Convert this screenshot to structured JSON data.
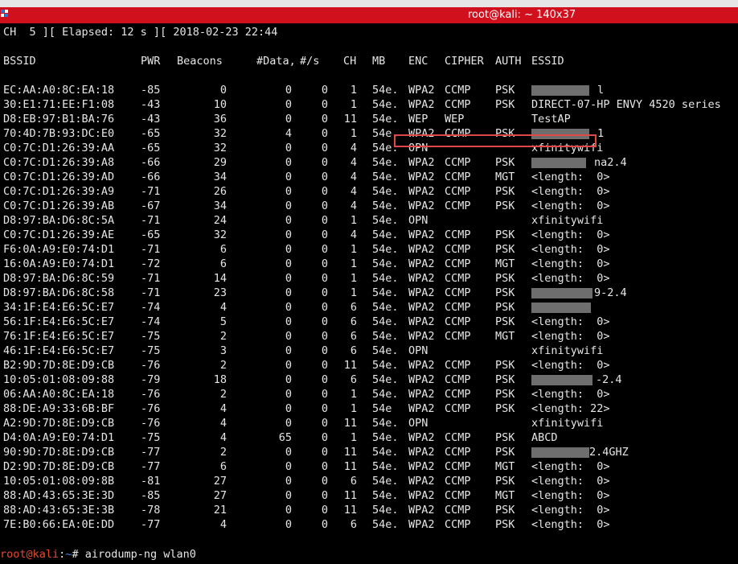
{
  "window": {
    "title": "root@kali: ~ 140x37"
  },
  "status_line": "CH  5 ][ Elapsed: 12 s ][ 2018-02-23 22:44",
  "columns": [
    "BSSID",
    "PWR",
    "Beacons",
    "#Data,",
    "#/s",
    "CH",
    "MB",
    "ENC",
    "CIPHER",
    "AUTH",
    "ESSID"
  ],
  "rows": [
    {
      "bssid": "EC:AA:A0:8C:EA:18",
      "pwr": "-85",
      "beacons": "0",
      "data": "0",
      "rate": "0",
      "ch": "1",
      "mb": "54e.",
      "enc": "WPA2",
      "cipher": "CCMP",
      "auth": "PSK",
      "essid": "l",
      "redacted": true
    },
    {
      "bssid": "30:E1:71:EE:F1:08",
      "pwr": "-43",
      "beacons": "10",
      "data": "0",
      "rate": "0",
      "ch": "1",
      "mb": "54e.",
      "enc": "WPA2",
      "cipher": "CCMP",
      "auth": "PSK",
      "essid": "DIRECT-07-HP ENVY 4520 series",
      "redacted": false
    },
    {
      "bssid": "D8:EB:97:B1:BA:76",
      "pwr": "-43",
      "beacons": "36",
      "data": "0",
      "rate": "0",
      "ch": "11",
      "mb": "54e.",
      "enc": "WEP",
      "cipher": "WEP",
      "auth": "",
      "essid": "TestAP",
      "redacted": false,
      "highlighted": true
    },
    {
      "bssid": "70:4D:7B:93:DC:E0",
      "pwr": "-65",
      "beacons": "32",
      "data": "4",
      "rate": "0",
      "ch": "1",
      "mb": "54e.",
      "enc": "WPA2",
      "cipher": "CCMP",
      "auth": "PSK",
      "essid": "1",
      "redacted": true
    },
    {
      "bssid": "C0:7C:D1:26:39:AA",
      "pwr": "-65",
      "beacons": "32",
      "data": "0",
      "rate": "0",
      "ch": "4",
      "mb": "54e.",
      "enc": "OPN",
      "cipher": "",
      "auth": "",
      "essid": "xfinitywifi",
      "redacted": false
    },
    {
      "bssid": "C0:7C:D1:26:39:A8",
      "pwr": "-66",
      "beacons": "29",
      "data": "0",
      "rate": "0",
      "ch": "4",
      "mb": "54e.",
      "enc": "WPA2",
      "cipher": "CCMP",
      "auth": "PSK",
      "essid": "na2.4",
      "redacted": true
    },
    {
      "bssid": "C0:7C:D1:26:39:AD",
      "pwr": "-66",
      "beacons": "34",
      "data": "0",
      "rate": "0",
      "ch": "4",
      "mb": "54e.",
      "enc": "WPA2",
      "cipher": "CCMP",
      "auth": "MGT",
      "essid": "<length:  0>",
      "redacted": false
    },
    {
      "bssid": "C0:7C:D1:26:39:A9",
      "pwr": "-71",
      "beacons": "26",
      "data": "0",
      "rate": "0",
      "ch": "4",
      "mb": "54e.",
      "enc": "WPA2",
      "cipher": "CCMP",
      "auth": "PSK",
      "essid": "<length:  0>",
      "redacted": false
    },
    {
      "bssid": "C0:7C:D1:26:39:AB",
      "pwr": "-67",
      "beacons": "34",
      "data": "0",
      "rate": "0",
      "ch": "4",
      "mb": "54e.",
      "enc": "WPA2",
      "cipher": "CCMP",
      "auth": "PSK",
      "essid": "<length:  0>",
      "redacted": false
    },
    {
      "bssid": "D8:97:BA:D6:8C:5A",
      "pwr": "-71",
      "beacons": "24",
      "data": "0",
      "rate": "0",
      "ch": "1",
      "mb": "54e.",
      "enc": "OPN",
      "cipher": "",
      "auth": "",
      "essid": "xfinitywifi",
      "redacted": false
    },
    {
      "bssid": "C0:7C:D1:26:39:AE",
      "pwr": "-65",
      "beacons": "32",
      "data": "0",
      "rate": "0",
      "ch": "4",
      "mb": "54e.",
      "enc": "WPA2",
      "cipher": "CCMP",
      "auth": "PSK",
      "essid": "<length:  0>",
      "redacted": false
    },
    {
      "bssid": "F6:0A:A9:E0:74:D1",
      "pwr": "-71",
      "beacons": "6",
      "data": "0",
      "rate": "0",
      "ch": "1",
      "mb": "54e.",
      "enc": "WPA2",
      "cipher": "CCMP",
      "auth": "PSK",
      "essid": "<length:  0>",
      "redacted": false
    },
    {
      "bssid": "16:0A:A9:E0:74:D1",
      "pwr": "-72",
      "beacons": "6",
      "data": "0",
      "rate": "0",
      "ch": "1",
      "mb": "54e.",
      "enc": "WPA2",
      "cipher": "CCMP",
      "auth": "MGT",
      "essid": "<length:  0>",
      "redacted": false
    },
    {
      "bssid": "D8:97:BA:D6:8C:59",
      "pwr": "-71",
      "beacons": "14",
      "data": "0",
      "rate": "0",
      "ch": "1",
      "mb": "54e.",
      "enc": "WPA2",
      "cipher": "CCMP",
      "auth": "PSK",
      "essid": "<length:  0>",
      "redacted": false
    },
    {
      "bssid": "D8:97:BA:D6:8C:58",
      "pwr": "-71",
      "beacons": "23",
      "data": "0",
      "rate": "0",
      "ch": "1",
      "mb": "54e.",
      "enc": "WPA2",
      "cipher": "CCMP",
      "auth": "PSK",
      "essid": "9-2.4",
      "redacted": true
    },
    {
      "bssid": "34:1F:E4:E6:5C:E7",
      "pwr": "-74",
      "beacons": "4",
      "data": "0",
      "rate": "0",
      "ch": "6",
      "mb": "54e.",
      "enc": "WPA2",
      "cipher": "CCMP",
      "auth": "PSK",
      "essid": "",
      "redacted": true
    },
    {
      "bssid": "56:1F:E4:E6:5C:E7",
      "pwr": "-74",
      "beacons": "5",
      "data": "0",
      "rate": "0",
      "ch": "6",
      "mb": "54e.",
      "enc": "WPA2",
      "cipher": "CCMP",
      "auth": "PSK",
      "essid": "<length:  0>",
      "redacted": false
    },
    {
      "bssid": "76:1F:E4:E6:5C:E7",
      "pwr": "-75",
      "beacons": "2",
      "data": "0",
      "rate": "0",
      "ch": "6",
      "mb": "54e.",
      "enc": "WPA2",
      "cipher": "CCMP",
      "auth": "MGT",
      "essid": "<length:  0>",
      "redacted": false
    },
    {
      "bssid": "46:1F:E4:E6:5C:E7",
      "pwr": "-75",
      "beacons": "3",
      "data": "0",
      "rate": "0",
      "ch": "6",
      "mb": "54e.",
      "enc": "OPN",
      "cipher": "",
      "auth": "",
      "essid": "xfinitywifi",
      "redacted": false
    },
    {
      "bssid": "B2:9D:7D:8E:D9:CB",
      "pwr": "-76",
      "beacons": "2",
      "data": "0",
      "rate": "0",
      "ch": "11",
      "mb": "54e.",
      "enc": "WPA2",
      "cipher": "CCMP",
      "auth": "PSK",
      "essid": "<length:  0>",
      "redacted": false
    },
    {
      "bssid": "10:05:01:08:09:88",
      "pwr": "-79",
      "beacons": "18",
      "data": "0",
      "rate": "0",
      "ch": "6",
      "mb": "54e.",
      "enc": "WPA2",
      "cipher": "CCMP",
      "auth": "PSK",
      "essid": "-2.4",
      "redacted": true
    },
    {
      "bssid": "06:AA:A0:8C:EA:18",
      "pwr": "-76",
      "beacons": "2",
      "data": "0",
      "rate": "0",
      "ch": "1",
      "mb": "54e.",
      "enc": "WPA2",
      "cipher": "CCMP",
      "auth": "PSK",
      "essid": "<length:  0>",
      "redacted": false
    },
    {
      "bssid": "88:DE:A9:33:6B:BF",
      "pwr": "-76",
      "beacons": "4",
      "data": "0",
      "rate": "0",
      "ch": "1",
      "mb": "54e",
      "enc": "WPA2",
      "cipher": "CCMP",
      "auth": "PSK",
      "essid": "<length: 22>",
      "redacted": false
    },
    {
      "bssid": "A2:9D:7D:8E:D9:CB",
      "pwr": "-76",
      "beacons": "4",
      "data": "0",
      "rate": "0",
      "ch": "11",
      "mb": "54e.",
      "enc": "OPN",
      "cipher": "",
      "auth": "",
      "essid": "xfinitywifi",
      "redacted": false
    },
    {
      "bssid": "D4:0A:A9:E0:74:D1",
      "pwr": "-75",
      "beacons": "4",
      "data": "65",
      "rate": "0",
      "ch": "1",
      "mb": "54e.",
      "enc": "WPA2",
      "cipher": "CCMP",
      "auth": "PSK",
      "essid": "ABCD",
      "redacted": false
    },
    {
      "bssid": "90:9D:7D:8E:D9:CB",
      "pwr": "-77",
      "beacons": "2",
      "data": "0",
      "rate": "0",
      "ch": "11",
      "mb": "54e.",
      "enc": "WPA2",
      "cipher": "CCMP",
      "auth": "PSK",
      "essid": "2.4GHZ",
      "redacted": true
    },
    {
      "bssid": "D2:9D:7D:8E:D9:CB",
      "pwr": "-77",
      "beacons": "6",
      "data": "0",
      "rate": "0",
      "ch": "11",
      "mb": "54e.",
      "enc": "WPA2",
      "cipher": "CCMP",
      "auth": "MGT",
      "essid": "<length:  0>",
      "redacted": false
    },
    {
      "bssid": "10:05:01:08:09:8B",
      "pwr": "-81",
      "beacons": "27",
      "data": "0",
      "rate": "0",
      "ch": "6",
      "mb": "54e.",
      "enc": "WPA2",
      "cipher": "CCMP",
      "auth": "PSK",
      "essid": "<length:  0>",
      "redacted": false
    },
    {
      "bssid": "88:AD:43:65:3E:3D",
      "pwr": "-85",
      "beacons": "27",
      "data": "0",
      "rate": "0",
      "ch": "11",
      "mb": "54e.",
      "enc": "WPA2",
      "cipher": "CCMP",
      "auth": "MGT",
      "essid": "<length:  0>",
      "redacted": false
    },
    {
      "bssid": "88:AD:43:65:3E:3B",
      "pwr": "-78",
      "beacons": "21",
      "data": "0",
      "rate": "0",
      "ch": "11",
      "mb": "54e.",
      "enc": "WPA2",
      "cipher": "CCMP",
      "auth": "PSK",
      "essid": "<length:  0>",
      "redacted": false
    },
    {
      "bssid": "7E:B0:66:EA:0E:DD",
      "pwr": "-77",
      "beacons": "4",
      "data": "0",
      "rate": "0",
      "ch": "6",
      "mb": "54e.",
      "enc": "WPA2",
      "cipher": "CCMP",
      "auth": "PSK",
      "essid": "<length:  0>",
      "redacted": false
    }
  ],
  "prompt": {
    "user_host": "root@kali",
    "sep": ":",
    "path": "~",
    "symbol": "# ",
    "command": "airodump-ng wlan0"
  },
  "colors": {
    "titlebar": "#d1101e",
    "background": "#000000",
    "foreground": "#e6e6e6",
    "highlight_box": "#e04848",
    "prompt_user": "#e64a2e",
    "prompt_path": "#4a7fd6",
    "redaction": "#6e6e6e"
  }
}
